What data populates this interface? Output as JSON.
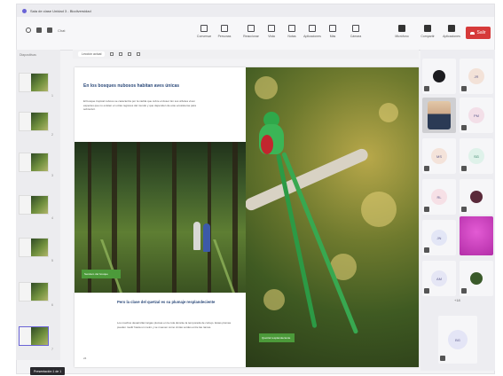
{
  "window": {
    "title": "Sala de clase Unidad 3 - Biodiversidad"
  },
  "toolbar": {
    "tenant": "Chat",
    "buttons": [
      {
        "label": "Conversar",
        "icon": "chat-icon"
      },
      {
        "label": "Personas",
        "icon": "people-icon"
      },
      {
        "label": "Reaccionar",
        "icon": "reaction-icon"
      },
      {
        "label": "Vista",
        "icon": "view-icon"
      },
      {
        "label": "Notas",
        "icon": "notes-icon"
      },
      {
        "label": "Aplicaciones",
        "icon": "apps-icon"
      },
      {
        "label": "Más",
        "icon": "more-icon"
      },
      {
        "label": "Cámara",
        "icon": "camera-icon"
      },
      {
        "label": "Micrófono",
        "icon": "microphone-icon"
      },
      {
        "label": "Compartir",
        "icon": "share-icon"
      }
    ],
    "leave_label": "Salir"
  },
  "sidebar": {
    "header": "Diapositivas",
    "thumbs": [
      "1",
      "2",
      "3",
      "4",
      "5",
      "6",
      "7"
    ]
  },
  "slide": {
    "tab_label": "Lección actual",
    "heading": "En los bosques nubosos habitan aves únicas",
    "paragraph": "El bosque tropical nuboso se caracteriza por la niebla que cubre el dosel. En sus árboles viven especies que no existen en otras regiones del mundo y que dependen de este ecosistema para sobrevivir.",
    "caption_left": "Sendero del bosque",
    "heading2": "Pero la clave del quetzal es su plumaje resplandeciente",
    "paragraph2": "Los machos desarrollan largas plumas en la cola durante la temporada de cortejo. Estas plumas pueden medir hasta un metro y se mueven como cintas verdes entre las ramas.",
    "caption_right": "Quetzal resplandeciente",
    "page_number": "24"
  },
  "participants": {
    "initials": [
      "JR",
      "PM",
      "MS",
      "SG",
      "RL",
      "JN",
      "AM",
      "LC",
      "EG",
      "BG"
    ],
    "more_label": "+18"
  },
  "statusbar": {
    "text": "Presentación 1 de 1"
  }
}
